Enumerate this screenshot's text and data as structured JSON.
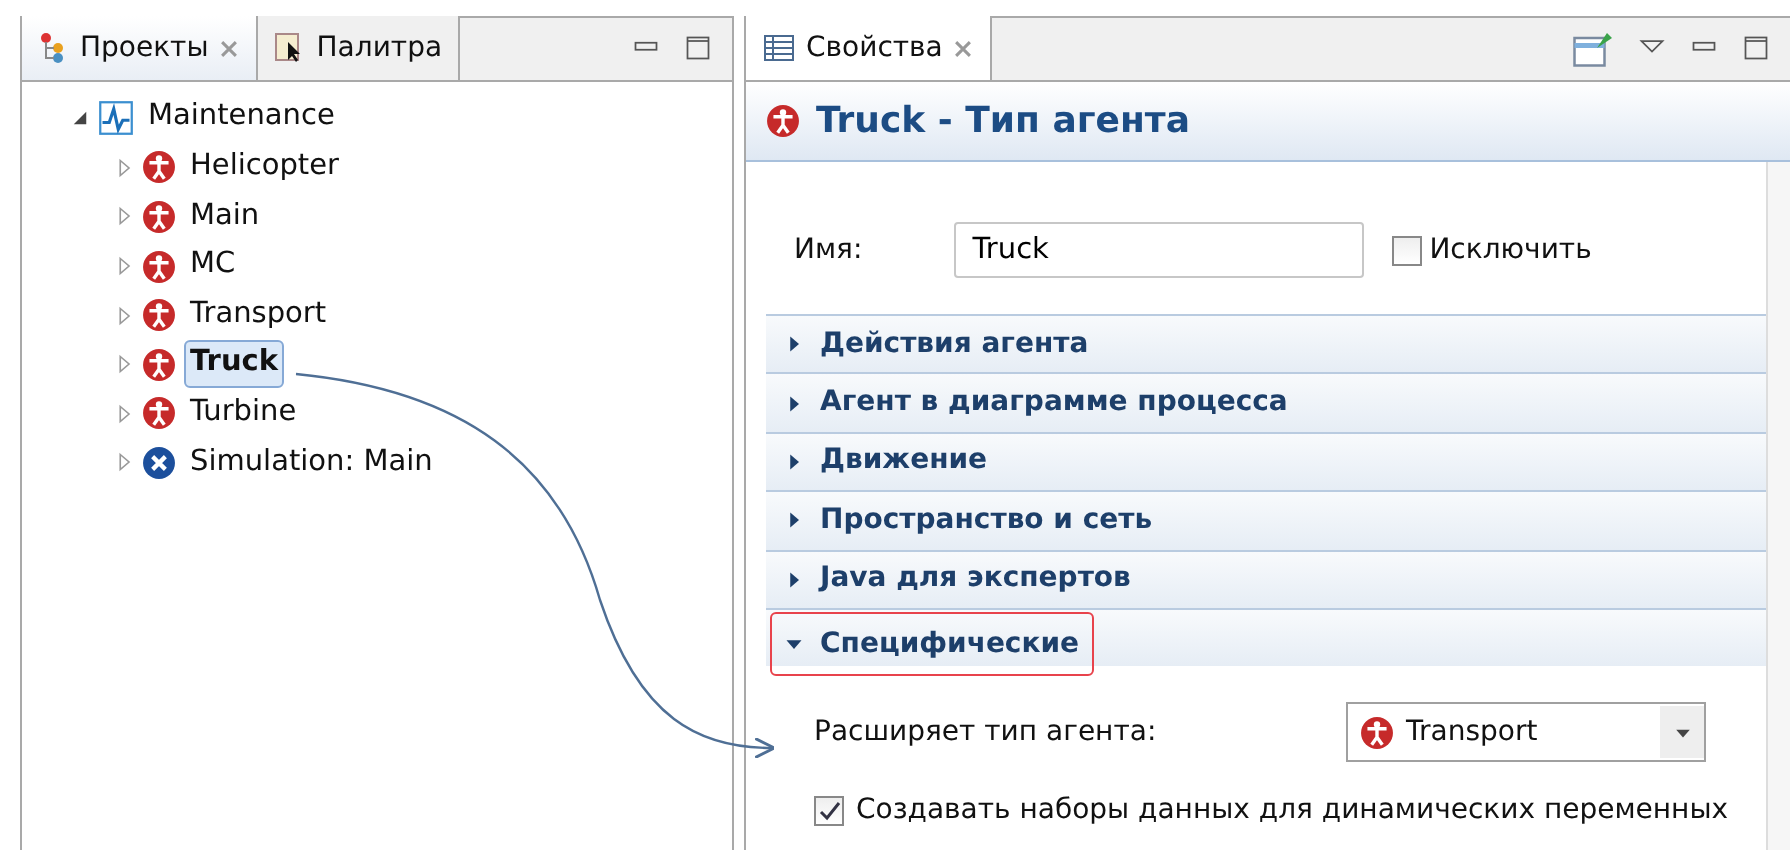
{
  "left_panel": {
    "tabs": [
      {
        "label": "Проекты",
        "selected": true
      },
      {
        "label": "Палитра",
        "selected": false
      }
    ],
    "tree": [
      {
        "label": "Maintenance",
        "kind": "model",
        "expanded": true,
        "selected": false,
        "children": [
          {
            "label": "Helicopter",
            "kind": "agent",
            "expanded": false,
            "selected": false
          },
          {
            "label": "Main",
            "kind": "agent",
            "expanded": false,
            "selected": false
          },
          {
            "label": "MC",
            "kind": "agent",
            "expanded": false,
            "selected": false
          },
          {
            "label": "Transport",
            "kind": "agent",
            "expanded": false,
            "selected": false
          },
          {
            "label": "Truck",
            "kind": "agent",
            "expanded": false,
            "selected": true
          },
          {
            "label": "Turbine",
            "kind": "agent",
            "expanded": false,
            "selected": false
          },
          {
            "label": "Simulation: Main",
            "kind": "simulation",
            "expanded": false,
            "selected": false
          }
        ]
      }
    ]
  },
  "right_panel": {
    "tab": {
      "label": "Свойства",
      "selected": true
    },
    "title": "Truck - Тип агента",
    "name_label": "Имя:",
    "name_value": "Truck",
    "exclude": {
      "label": "Исключить",
      "checked": false
    },
    "sections": [
      {
        "label": "Действия агента",
        "expanded": false,
        "highlighted": false
      },
      {
        "label": "Агент в диаграмме процесса",
        "expanded": false,
        "highlighted": false
      },
      {
        "label": "Движение",
        "expanded": false,
        "highlighted": false
      },
      {
        "label": "Пространство и сеть",
        "expanded": false,
        "highlighted": false
      },
      {
        "label": "Java для экспертов",
        "expanded": false,
        "highlighted": false
      },
      {
        "label": "Специфические",
        "expanded": true,
        "highlighted": true
      }
    ],
    "extends_label": "Расширяет тип агента:",
    "extends_value": "Transport",
    "datasets": {
      "label": "Создавать наборы данных для динамических переменных",
      "checked": true
    }
  }
}
